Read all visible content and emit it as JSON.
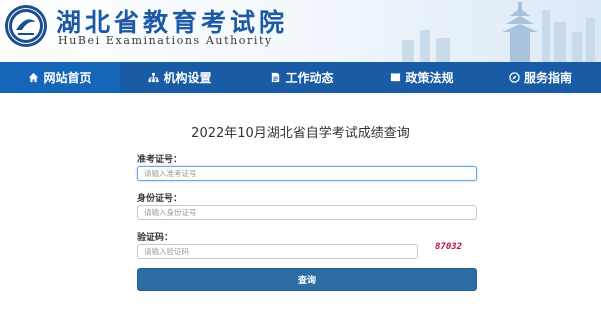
{
  "header": {
    "title": "湖北省教育考试院",
    "subtitle": "HuBei Examinations Authority"
  },
  "nav": {
    "items": [
      {
        "label": "网站首页",
        "icon": "home-icon",
        "active": true
      },
      {
        "label": "机构设置",
        "icon": "org-chart-icon",
        "active": false
      },
      {
        "label": "工作动态",
        "icon": "document-icon",
        "active": false
      },
      {
        "label": "政策法规",
        "icon": "book-icon",
        "active": false
      },
      {
        "label": "服务指南",
        "icon": "compass-icon",
        "active": false
      }
    ]
  },
  "form": {
    "title": "2022年10月湖北省自学考试成绩查询",
    "exam_id": {
      "label": "准考证号：",
      "placeholder": "请输入准考证号",
      "value": ""
    },
    "id_card": {
      "label": "身份证号：",
      "placeholder": "请输入身份证号",
      "value": ""
    },
    "captcha": {
      "label": "验证码：",
      "placeholder": "请输入验证码",
      "value": "",
      "code": "87032"
    },
    "submit_label": "查询"
  },
  "colors": {
    "nav_bg": "#1a5ba6",
    "button_bg": "#2e6da4",
    "title_blue": "#1d5aa4",
    "captcha_color": "#b2154a"
  }
}
